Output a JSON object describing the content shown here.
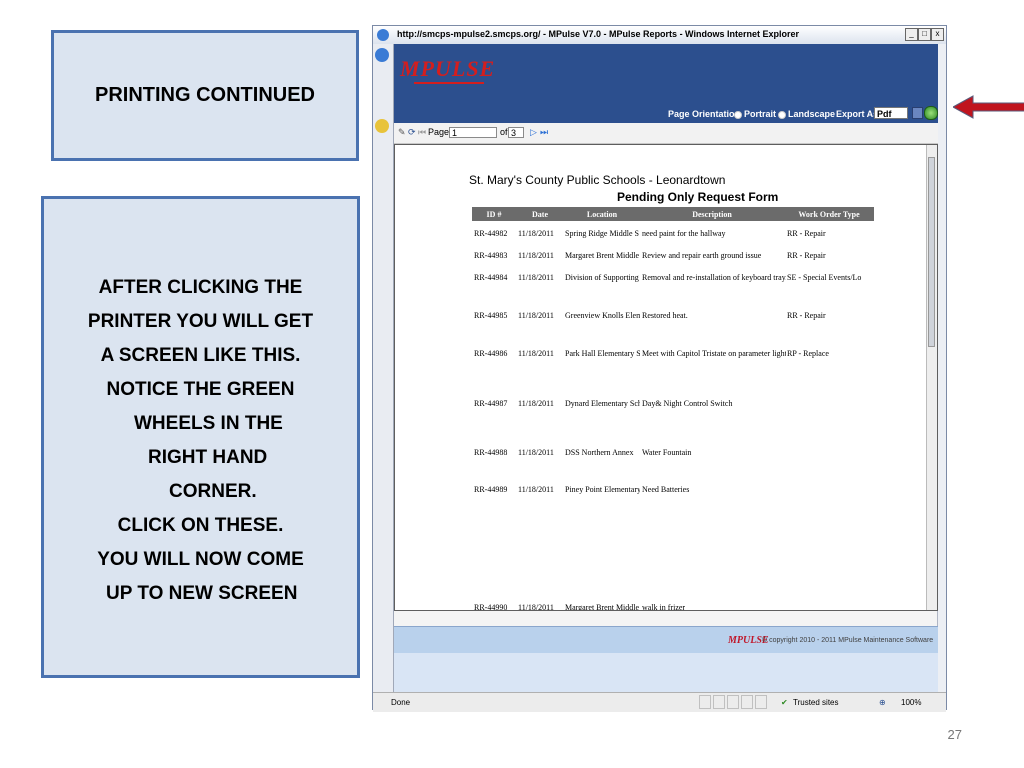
{
  "slide": {
    "title": "PRINTING CONTINUED",
    "instructions": [
      "AFTER CLICKING THE",
      "PRINTER YOU WILL GET",
      "A SCREEN LIKE THIS.",
      "NOTICE THE GREEN",
      "WHEELS IN THE",
      "RIGHT HAND",
      "CORNER.",
      "CLICK ON THESE.",
      "YOU WILL NOW COME",
      "UP TO NEW SCREEN"
    ],
    "page_number": "27"
  },
  "browser": {
    "title": "http://smcps-mpulse2.smcps.org/ - MPulse V7.0 - MPulse Reports - Windows Internet Explorer",
    "controls": {
      "minimize": "_",
      "maximize": "□",
      "close": "x"
    }
  },
  "app": {
    "logo_text": "MPULSE",
    "page_orientation_label": "Page Orientation",
    "portrait_label": "Portrait",
    "landscape_label": "Landscape",
    "export_as_label": "Export As",
    "export_format": "Pdf"
  },
  "report_toolbar": {
    "page_label": "Page",
    "page_value": "1",
    "of_label": "of",
    "total_pages": "3"
  },
  "report": {
    "school": "St. Mary's County Public Schools  - Leonardtown",
    "form_title": "Pending Only Request Form",
    "columns": [
      "ID #",
      "Date",
      "Location",
      "Description",
      "Work Order Type"
    ],
    "rows": [
      {
        "id": "RR-44982",
        "date": "11/18/2011",
        "location": "Spring Ridge Middle S",
        "description": "need paint for the hallway",
        "type": "RR - Repair"
      },
      {
        "id": "RR-44983",
        "date": "11/18/2011",
        "location": "Margaret Brent Middle",
        "description": "Review and repair earth ground issue",
        "type": "RR - Repair"
      },
      {
        "id": "RR-44984",
        "date": "11/18/2011",
        "location": "Division of Supporting",
        "description": "Removal and re-installation of keyboard tray.",
        "type": "SE - Special Events/Lo"
      },
      {
        "id": "RR-44985",
        "date": "11/18/2011",
        "location": "Greenview Knolls Elem",
        "description": "Restored heat.",
        "type": "RR - Repair"
      },
      {
        "id": "RR-44986",
        "date": "11/18/2011",
        "location": "Park Hall Elementary S",
        "description": "Meet with Capitol Tristate on parameter lightin",
        "type": "RP - Replace"
      },
      {
        "id": "RR-44987",
        "date": "11/18/2011",
        "location": "Dynard Elementary Sch",
        "description": "Day& Night Control Switch",
        "type": ""
      },
      {
        "id": "RR-44988",
        "date": "11/18/2011",
        "location": "DSS Northern Annex",
        "description": "Water Fountain",
        "type": ""
      },
      {
        "id": "RR-44989",
        "date": "11/18/2011",
        "location": "Piney Point Elementary",
        "description": "Need Batteries",
        "type": ""
      },
      {
        "id": "RR-44990",
        "date": "11/18/2011",
        "location": "Margaret Brent Middle",
        "description": "walk in frizer",
        "type": ""
      }
    ]
  },
  "footer": {
    "logo": "MPULSE",
    "copyright": "© copyright 2010 - 2011 MPulse Maintenance Software"
  },
  "statusbar": {
    "status": "Done",
    "zone": "Trusted sites",
    "zoom": "100%"
  },
  "colors": {
    "callout_fill": "#dbe4f0",
    "callout_border": "#4a72b0",
    "app_header": "#2c4f8e",
    "logo_red": "#d41e1e",
    "arrow_red": "#c0141e",
    "green_wheels": "#2e8a24"
  }
}
